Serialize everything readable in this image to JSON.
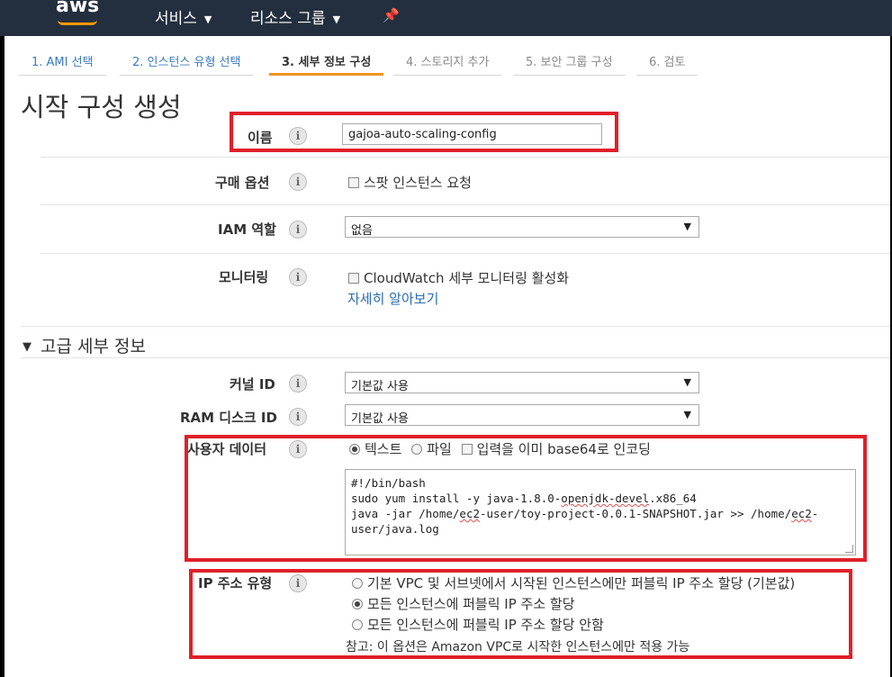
{
  "header": {
    "logo": "aws",
    "services": "서비스",
    "resource_groups": "리소스 그룹",
    "pin_icon": "pin-icon"
  },
  "tabs": [
    {
      "label": "1. AMI 선택",
      "state": "link"
    },
    {
      "label": "2. 인스턴스 유형 선택",
      "state": "link"
    },
    {
      "label": "3. 세부 정보 구성",
      "state": "active"
    },
    {
      "label": "4. 스토리지 추가",
      "state": "disabled"
    },
    {
      "label": "5. 보안 그룹 구성",
      "state": "disabled"
    },
    {
      "label": "6. 검토",
      "state": "disabled"
    }
  ],
  "page_title": "시작 구성 생성",
  "form": {
    "name_label": "이름",
    "name_value": "gajoa-auto-scaling-config",
    "purchase_label": "구매 옵션",
    "purchase_checkbox": "스팟 인스턴스 요청",
    "iam_label": "IAM 역할",
    "iam_value": "없음",
    "monitoring_label": "모니터링",
    "monitoring_checkbox": "CloudWatch 세부 모니터링 활성화",
    "monitoring_link": "자세히 알아보기"
  },
  "advanced": {
    "section_title": "고급 세부 정보",
    "kernel_label": "커널 ID",
    "kernel_value": "기본값 사용",
    "ramdisk_label": "RAM 디스크 ID",
    "ramdisk_value": "기본값 사용",
    "userdata_label": "사용자 데이터",
    "userdata_opt_text": "텍스트",
    "userdata_opt_file": "파일",
    "userdata_base64": "입력을 이미 base64로 인코딩",
    "userdata_line1": "#!/bin/bash",
    "userdata_line2a": "sudo yum install -y java-1.8.0-",
    "userdata_line2b": "openjdk-devel",
    "userdata_line2c": ".x86_64",
    "userdata_line3a": "java -jar /home/",
    "userdata_line3b": "ec2",
    "userdata_line3c": "-user/toy-project-0.0.1-SNAPSHOT.jar >> /home/",
    "userdata_line3d": "ec2",
    "userdata_line3e": "-",
    "userdata_line4": "user/java.log",
    "ip_label": "IP 주소 유형",
    "ip_opt1": "기본 VPC 및 서브넷에서 시작된 인스턴스에만 퍼블릭 IP 주소 할당 (기본값)",
    "ip_opt2": "모든 인스턴스에 퍼블릭 IP 주소 할당",
    "ip_opt3": "모든 인스턴스에 퍼블릭 IP 주소 할당 안함",
    "ip_note": "참고: 이 옵션은 Amazon VPC로 시작한 인스턴스에만 적용 가능"
  },
  "colors": {
    "header_bg": "#232f3e",
    "accent_orange": "#f09420",
    "highlight_red": "#e0202a",
    "link_blue": "#2a6db0"
  }
}
